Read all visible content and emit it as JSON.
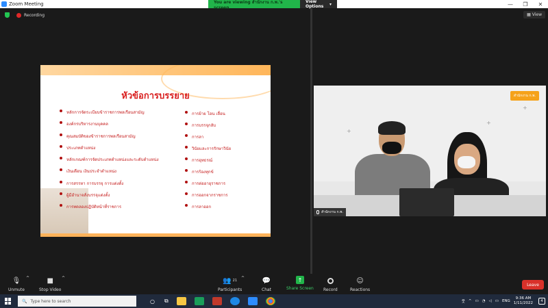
{
  "window": {
    "title": "Zoom Meeting",
    "controls": [
      "—",
      "❐",
      "✕"
    ]
  },
  "viewing_banner": {
    "message": "You are viewing สำนักงาน ก.พ.'s screen",
    "options_label": "View Options"
  },
  "status": {
    "recording_label": "Recording",
    "view_button": "View"
  },
  "slide": {
    "title": "หัวข้อการบรรยาย",
    "left_items": [
      "หลักการจัดระเบียบข้าราชการพลเรือนสามัญ",
      "องค์กรบริหารงานบุคคล",
      "คุณสมบัติของข้าราชการพลเรือนสามัญ",
      "ประเภทตำแหน่ง",
      "หลักเกณฑ์การจัดประเภทตำแหน่งและระดับตำแหน่ง",
      "เงินเดือน เงินประจำตำแหน่ง",
      "การสรรหา การบรรจุ การแต่งตั้ง",
      "ผู้มีอำนาจสั่งบรรจุแต่งตั้ง",
      "การทดลองปฏิบัติหน้าที่ราชการ"
    ],
    "right_items": [
      "การย้าย โอน เลื่อน",
      "การบรรจุกลับ",
      "การลา",
      "วินัยและการรักษาวินัย",
      "การอุทธรณ์",
      "การร้องทุกข์",
      "การต่ออายุราชการ",
      "การออกจากราชการ",
      "การลาออก"
    ]
  },
  "video": {
    "logo_text": "สำนักงาน ก.พ.",
    "participant_name": "สำนักงาน ก.พ."
  },
  "toolbar": {
    "unmute": "Unmute",
    "stop_video": "Stop Video",
    "participants": "Participants",
    "participants_count": "21",
    "chat": "Chat",
    "share_screen": "Share Screen",
    "record": "Record",
    "reactions": "Reactions",
    "leave": "Leave"
  },
  "taskbar": {
    "search_placeholder": "Type here to search",
    "language": "ENG",
    "time": "9:36 AM",
    "date": "1/11/2022",
    "notifications": "4"
  },
  "colors": {
    "zoom_blue": "#2d8cff",
    "banner_green": "#21b54a",
    "leave_red": "#d9312a",
    "slide_title_red": "#d92020",
    "slide_accent_orange": "#ffb35a"
  }
}
